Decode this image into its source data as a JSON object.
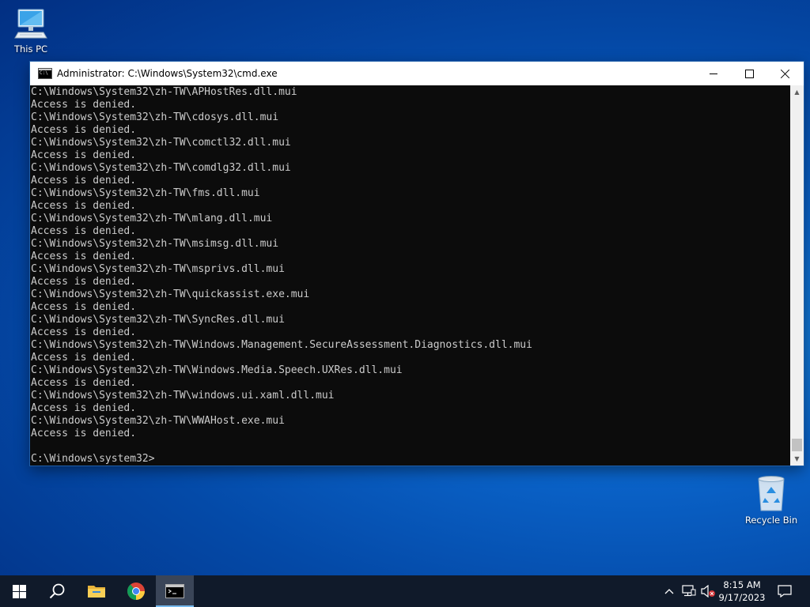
{
  "desktop": {
    "icons": [
      {
        "label": "This PC",
        "icon": "this-pc-icon"
      },
      {
        "label": "Recycle Bin",
        "icon": "recycle-bin-icon"
      }
    ]
  },
  "window": {
    "title": "Administrator: C:\\Windows\\System32\\cmd.exe",
    "icon": "console-icon",
    "controls": [
      "minimize-icon",
      "maximize-icon",
      "close-icon"
    ]
  },
  "console": {
    "lines": [
      "C:\\Windows\\System32\\zh-TW\\APHostRes.dll.mui",
      "Access is denied.",
      "C:\\Windows\\System32\\zh-TW\\cdosys.dll.mui",
      "Access is denied.",
      "C:\\Windows\\System32\\zh-TW\\comctl32.dll.mui",
      "Access is denied.",
      "C:\\Windows\\System32\\zh-TW\\comdlg32.dll.mui",
      "Access is denied.",
      "C:\\Windows\\System32\\zh-TW\\fms.dll.mui",
      "Access is denied.",
      "C:\\Windows\\System32\\zh-TW\\mlang.dll.mui",
      "Access is denied.",
      "C:\\Windows\\System32\\zh-TW\\msimsg.dll.mui",
      "Access is denied.",
      "C:\\Windows\\System32\\zh-TW\\msprivs.dll.mui",
      "Access is denied.",
      "C:\\Windows\\System32\\zh-TW\\quickassist.exe.mui",
      "Access is denied.",
      "C:\\Windows\\System32\\zh-TW\\SyncRes.dll.mui",
      "Access is denied.",
      "C:\\Windows\\System32\\zh-TW\\Windows.Management.SecureAssessment.Diagnostics.dll.mui",
      "Access is denied.",
      "C:\\Windows\\System32\\zh-TW\\Windows.Media.Speech.UXRes.dll.mui",
      "Access is denied.",
      "C:\\Windows\\System32\\zh-TW\\windows.ui.xaml.dll.mui",
      "Access is denied.",
      "C:\\Windows\\System32\\zh-TW\\WWAHost.exe.mui",
      "Access is denied.",
      "",
      "C:\\Windows\\system32>"
    ],
    "text_color": "#cccccc",
    "background": "#0c0c0c"
  },
  "taskbar": {
    "buttons": [
      "start-icon",
      "search-icon",
      "file-explorer-icon",
      "chrome-icon",
      "cmd-icon"
    ],
    "tray": {
      "icons": [
        "chevron-up-icon",
        "network-icon",
        "volume-muted-icon"
      ],
      "time": "8:15 AM",
      "date": "9/17/2023"
    },
    "background": "#101a2a",
    "active_indicator": "#76b9ed"
  }
}
